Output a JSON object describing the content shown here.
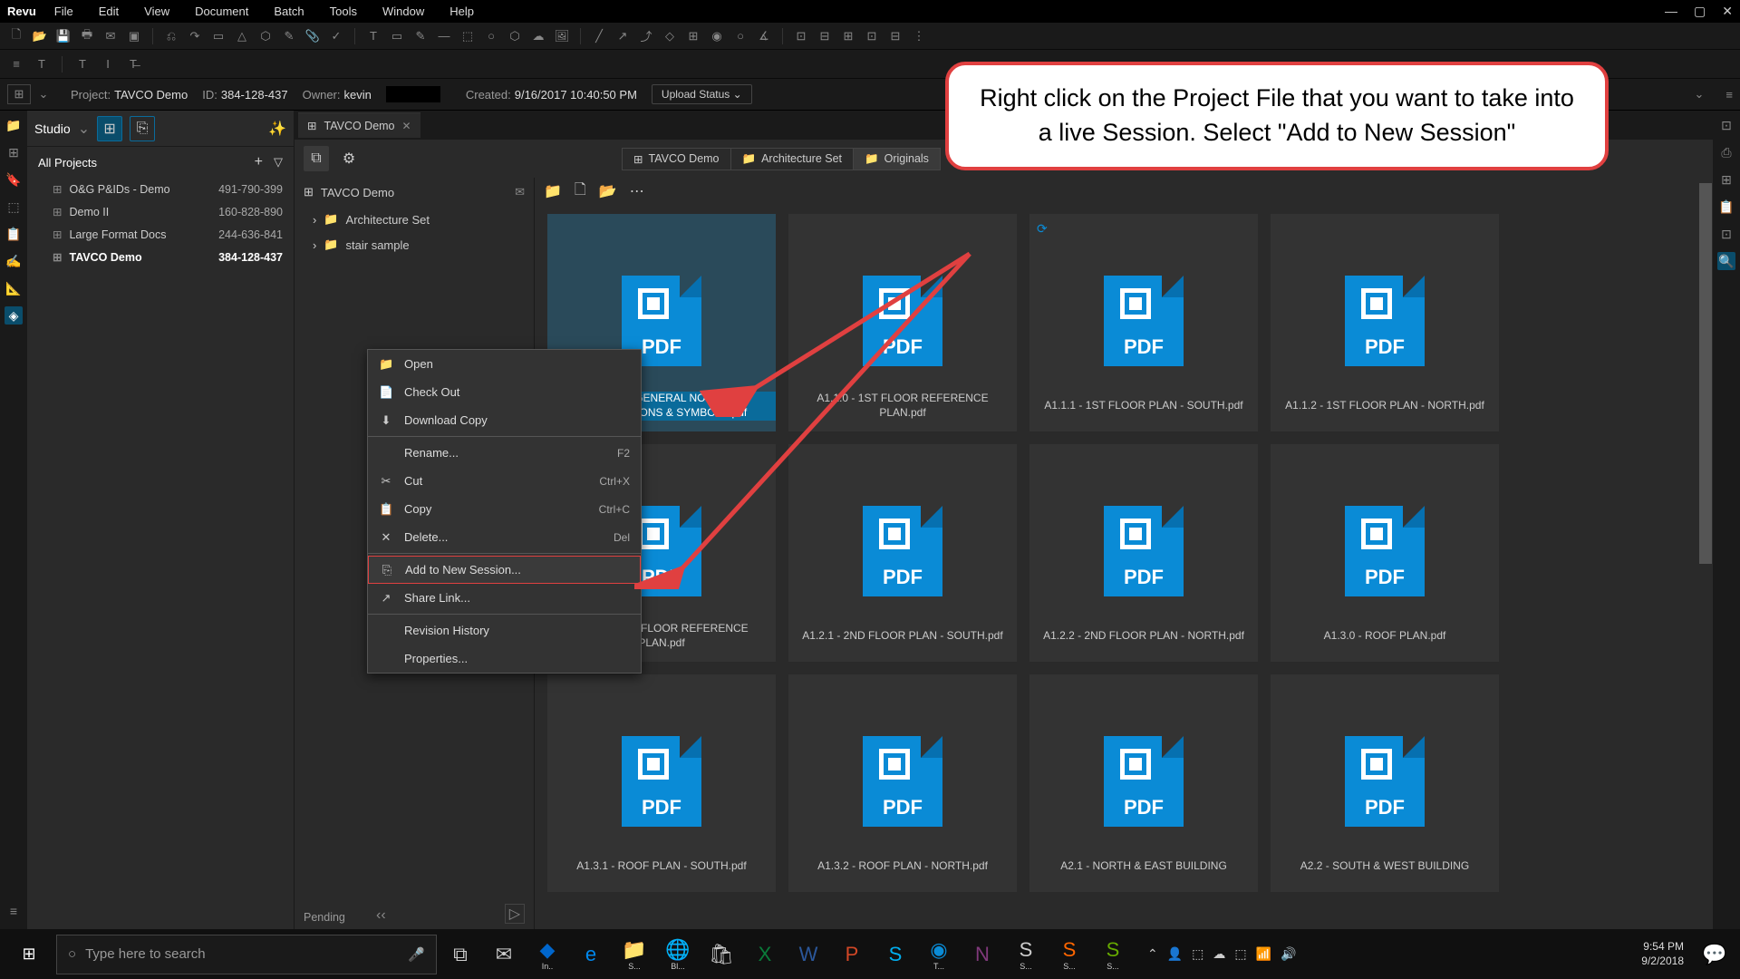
{
  "app_name": "Revu",
  "menu": [
    "File",
    "Edit",
    "View",
    "Document",
    "Batch",
    "Tools",
    "Window",
    "Help"
  ],
  "info": {
    "project_lbl": "Project:",
    "project_val": "TAVCO Demo",
    "id_lbl": "ID:",
    "id_val": "384-128-437",
    "owner_lbl": "Owner:",
    "owner_val": "kevin",
    "created_lbl": "Created:",
    "created_val": "9/16/2017 10:40:50 PM",
    "upload": "Upload Status"
  },
  "studio": {
    "title": "Studio",
    "allprojects": "All Projects",
    "projects": [
      {
        "name": "O&G P&IDs - Demo",
        "id": "491-790-399"
      },
      {
        "name": "Demo II",
        "id": "160-828-890"
      },
      {
        "name": "Large Format Docs",
        "id": "244-636-841"
      },
      {
        "name": "TAVCO Demo",
        "id": "384-128-437"
      }
    ]
  },
  "tab": "TAVCO Demo",
  "tree": {
    "root": "TAVCO Demo",
    "items": [
      "Architecture Set",
      "stair sample"
    ],
    "pending": "Pending"
  },
  "crumbs": [
    "TAVCO Demo",
    "Architecture Set",
    "Originals"
  ],
  "files": [
    "A1.0.1 - GENERAL NOTES, ABBREVIATIONS & SYMBOLS.pdf",
    "A1.1.0 - 1ST FLOOR REFERENCE PLAN.pdf",
    "A1.1.1 - 1ST FLOOR PLAN - SOUTH.pdf",
    "A1.1.2 - 1ST FLOOR PLAN - NORTH.pdf",
    "A1.2.0 - 2ND FLOOR REFERENCE PLAN.pdf",
    "A1.2.1 - 2ND FLOOR PLAN - SOUTH.pdf",
    "A1.2.2 - 2ND FLOOR PLAN - NORTH.pdf",
    "A1.3.0 - ROOF PLAN.pdf",
    "A1.3.1 - ROOF PLAN - SOUTH.pdf",
    "A1.3.2 - ROOF PLAN - NORTH.pdf",
    "A2.1 - NORTH & EAST BUILDING",
    "A2.2 - SOUTH & WEST BUILDING"
  ],
  "ctx": [
    {
      "icon": "📁",
      "label": "Open"
    },
    {
      "icon": "📄",
      "label": "Check Out"
    },
    {
      "icon": "⬇",
      "label": "Download Copy"
    },
    {
      "sep": true
    },
    {
      "icon": "",
      "label": "Rename...",
      "sc": "F2"
    },
    {
      "icon": "✂",
      "label": "Cut",
      "sc": "Ctrl+X"
    },
    {
      "icon": "📋",
      "label": "Copy",
      "sc": "Ctrl+C"
    },
    {
      "icon": "✕",
      "label": "Delete...",
      "sc": "Del"
    },
    {
      "sep": true
    },
    {
      "icon": "⎘",
      "label": "Add to New Session...",
      "hl": true
    },
    {
      "icon": "↗",
      "label": "Share Link..."
    },
    {
      "sep": true
    },
    {
      "icon": "",
      "label": "Revision History"
    },
    {
      "icon": "",
      "label": "Properties..."
    }
  ],
  "callout": "Right click on the Project File that you want to take into a live Session. Select \"Add to New Session\"",
  "taskbar": {
    "search_placeholder": "Type here to search",
    "time": "9:54 PM",
    "date": "9/2/2018",
    "apps": [
      "In..",
      "",
      "S...",
      "Bl...",
      "",
      "",
      "",
      "",
      "",
      "T...",
      "",
      "S...",
      "S...",
      "S...",
      ""
    ]
  },
  "pdf_label": "PDF"
}
